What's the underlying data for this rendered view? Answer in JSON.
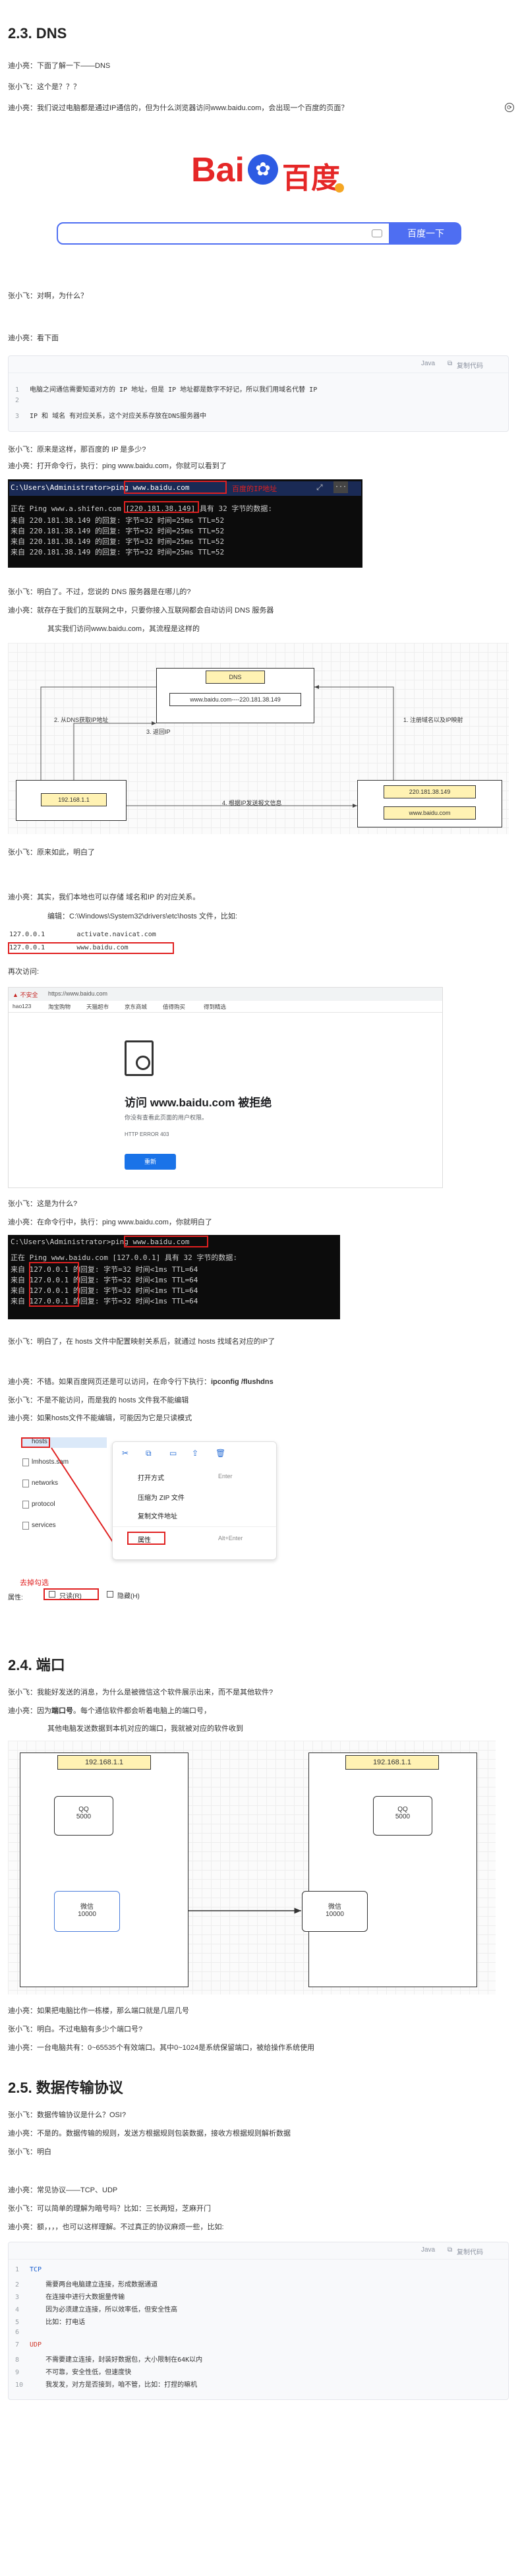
{
  "sec1": {
    "title": "2.3. DNS",
    "p1": "迪小亮：下面了解一下——DNS",
    "p2": "张小飞：这个是？？？",
    "p3": "迪小亮：我们说过电脑都是通过IP通信的，但为什么浏览器访问www.baidu.com，会出现一个百度的页面？",
    "baidu_logo_left": "Bai",
    "baidu_logo_right": "百度",
    "baidu_search_button": "百度一下",
    "p4": "张小飞：对啊，为什么？",
    "p5": "迪小亮：看下面",
    "code1_java": "Java",
    "code1_copy": "复制代码",
    "code1_lines": [
      {
        "n": "1",
        "t": "电脑之间通信需要知道对方的 IP 地址，但是 IP 地址都是数字不好记，所以我们用域名代替 IP"
      },
      {
        "n": "2",
        "t": ""
      },
      {
        "n": "3",
        "t": "IP 和 域名 有对应关系，这个对应关系存放在DNS服务器中"
      }
    ],
    "p6": "张小飞：原来是这样，那百度的 IP 是多少?",
    "p7": "迪小亮：打开命令行，执行：ping www.baidu.com，你就可以看到了",
    "term1": {
      "prompt": "C:\\Users\\Administrator>",
      "cmd": "ping www.baidu.com",
      "annotation": "百度的IP地址",
      "line1a": "正在 Ping www.a.shifen.com ",
      "line1ip": "[220.181.38.149]",
      "line1b": " 具有 32 字节的数据:",
      "lines": [
        "来自 220.181.38.149 的回复: 字节=32 时间=25ms TTL=52",
        "来自 220.181.38.149 的回复: 字节=32 时间=25ms TTL=52",
        "来自 220.181.38.149 的回复: 字节=32 时间=25ms TTL=52",
        "来自 220.181.38.149 的回复: 字节=32 时间=25ms TTL=52"
      ]
    },
    "p8": "张小飞：明白了。不过，您说的 DNS 服务器是在哪儿的?",
    "p9": "迪小亮：就存在于我们的互联网之中，只要你接入互联网都会自动访问 DNS 服务器",
    "p10": "其实我们访问www.baidu.com，其流程是这样的",
    "diagram1": {
      "dns_label": "DNS",
      "dns_inner": "www.baidu.com----220.181.38.149",
      "step1": "1. 注册域名以及IP映射",
      "step2": "2. 从DNS获取IP地址",
      "step3": "3. 返回IP",
      "step4": "4. 根据IP发送报文信息",
      "client_ip": "192.168.1.1",
      "server_ip": "220.181.38.149",
      "server_domain": "www.baidu.com"
    },
    "p11": "张小飞：原来如此，明白了",
    "p12": "迪小亮：其实，我们本地也可以存储 域名和IP 的对应关系。",
    "p13": "编辑：C:\\Windows\\System32\\drivers\\etc\\hosts 文件，比如:",
    "hosts_lines": [
      {
        "ip": "127.0.0.1",
        "name": "activate.navicat.com"
      },
      {
        "ip": "127.0.0.1",
        "name": "www.baidu.com"
      }
    ],
    "p14": "再次访问:",
    "browser": {
      "insecure": "不安全",
      "url": "https://www.baidu.com",
      "bookmarks": [
        "hao123",
        "淘宝购物",
        "天猫超市",
        "京东商城",
        "值得购买",
        "得到精选"
      ],
      "error_title": "访问 www.baidu.com 被拒绝",
      "error_sub": "你没有查看此页面的用户权限。",
      "error_code": "HTTP ERROR 403",
      "reload": "重新"
    },
    "p15": "张小飞：这是为什么?",
    "p16": "迪小亮：在命令行中，执行：ping www.baidu.com，你就明白了",
    "term2": {
      "prompt": "C:\\Users\\Administrator>",
      "cmd": "ping www.baidu.com",
      "line1": "正在 Ping www.baidu.com [127.0.0.1] 具有 32 字节的数据:",
      "lines": [
        "来自 127.0.0.1 的回复: 字节=32 时间<1ms TTL=64",
        "来自 127.0.0.1 的回复: 字节=32 时间<1ms TTL=64",
        "来自 127.0.0.1 的回复: 字节=32 时间<1ms TTL=64",
        "来自 127.0.0.1 的回复: 字节=32 时间<1ms TTL=64"
      ]
    },
    "p17": "张小飞：明白了，在 hosts 文件中配置映射关系后，就通过 hosts 找域名对应的IP了",
    "p18a": "迪小亮：不错。如果百度网页还是可以访问，在命令行下执行：",
    "p18b": "ipconfig /flushdns",
    "p19": "张小飞：不是不能访问，而是我的 hosts 文件我不能编辑",
    "p20": "迪小亮：如果hosts文件不能编辑，可能因为它是只读模式",
    "files": [
      "hosts",
      "lmhosts.sam",
      "networks",
      "protocol",
      "services"
    ],
    "context_menu": [
      {
        "label": "打开方式",
        "key": "Enter"
      },
      {
        "label": "压缩为 ZIP 文件",
        "key": ""
      },
      {
        "label": "复制文件地址",
        "key": ""
      },
      {
        "label": "属性",
        "key": "Alt+Enter"
      }
    ],
    "uncheck_note": "去掉勾选",
    "attr_label": "属性:",
    "readonly": "只读(R)",
    "hidden": "隐藏(H)"
  },
  "sec2": {
    "title": "2.4. 端口",
    "p1": "张小飞：我能好发送的消息，为什么是被微信这个软件展示出来，而不是其他软件?",
    "p2a": "迪小亮：因为",
    "p2b": "端口号",
    "p2c": "。每个通信软件都会听着电脑上的端口号，",
    "p3": "其他电脑发送数据到本机对应的端口，我就被对应的软件收到",
    "diagram2": {
      "left_ip": "192.168.1.1",
      "right_ip": "192.168.1.1",
      "qq": "QQ",
      "qq_port": "5000",
      "wx": "微信",
      "wx_port": "10000"
    },
    "p4": "迪小亮：如果把电脑比作一栋楼，那么端口就是几层几号",
    "p5": "张小飞：明白。不过电脑有多少个端口号?",
    "p6": "迪小亮：一台电脑共有：0~65535个有效端口。其中0~1024是系统保留端口，被给操作系统使用"
  },
  "sec3": {
    "title": "2.5. 数据传输协议",
    "p1": "张小飞：数据传输协议是什么？OSI?",
    "p2": "迪小亮：不是的。数据传输的规则，发送方根据规则包装数据，接收方根据规则解析数据",
    "p3": "张小飞：明白",
    "p4": "迪小亮：常见协议——TCP、UDP",
    "p5": "张小飞：可以简单的理解为暗号吗？比如：三长两短，芝麻开门",
    "p6": "迪小亮：额，，，，也可以这样理解。不过真正的协议麻烦一些，比如:",
    "code2_java": "Java",
    "code2_copy": "复制代码",
    "code2_lines": [
      {
        "n": "1",
        "t": "TCP",
        "c": "#1a5fd0"
      },
      {
        "n": "2",
        "t": "    需要两台电脑建立连接，形成数据通道",
        "c": "#333"
      },
      {
        "n": "3",
        "t": "    在连接中进行大数据量传输",
        "c": "#333"
      },
      {
        "n": "4",
        "t": "    因为必须建立连接，所以效率低，但安全性高",
        "c": "#333"
      },
      {
        "n": "5",
        "t": "    比如：打电话",
        "c": "#333"
      },
      {
        "n": "6",
        "t": "",
        "c": "#333"
      },
      {
        "n": "7",
        "t": "UDP",
        "c": "#d0382a"
      },
      {
        "n": "8",
        "t": "    不需要建立连接，封装好数据包，大小限制在64K以内",
        "c": "#333"
      },
      {
        "n": "9",
        "t": "    不可靠，安全性低，但速度快",
        "c": "#333"
      },
      {
        "n": "10",
        "t": "    我发发，对方是否接到，咱不管，比如：打捏的嘛机",
        "c": "#333"
      }
    ]
  },
  "colors": {
    "accent": "#4e6ef2",
    "red": "#e02020",
    "diagram_yellow": "#fff2b3"
  }
}
